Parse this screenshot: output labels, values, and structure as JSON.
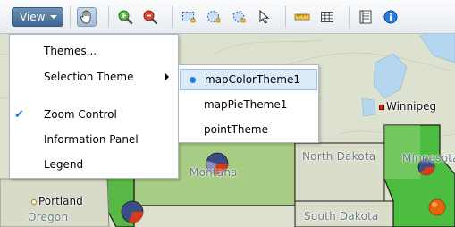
{
  "toolbar": {
    "view_label": "View",
    "tools": [
      {
        "name": "pan-hand-icon"
      },
      {
        "name": "zoom-in-icon"
      },
      {
        "name": "zoom-out-icon"
      },
      {
        "name": "rect-select-icon"
      },
      {
        "name": "circle-select-icon"
      },
      {
        "name": "polygon-select-icon"
      },
      {
        "name": "pointer-icon"
      },
      {
        "name": "distance-ruler-icon"
      },
      {
        "name": "grid-icon"
      },
      {
        "name": "information-panel-icon"
      },
      {
        "name": "legend-info-icon"
      }
    ]
  },
  "view_menu": {
    "items": [
      {
        "label": "Themes...",
        "checked": false,
        "submenu": false
      },
      {
        "label": "Selection Theme",
        "checked": false,
        "submenu": true
      },
      {
        "label": "Zoom Control",
        "checked": true,
        "submenu": false
      },
      {
        "label": "Information Panel",
        "checked": false,
        "submenu": false
      },
      {
        "label": "Legend",
        "checked": false,
        "submenu": false
      }
    ]
  },
  "selection_theme_menu": {
    "items": [
      {
        "label": "mapColorTheme1",
        "selected": true
      },
      {
        "label": "mapPieTheme1",
        "selected": false
      },
      {
        "label": "pointTheme",
        "selected": false
      }
    ]
  },
  "map": {
    "regions": [
      "Montana",
      "North Dakota",
      "South Dakota",
      "Oregon",
      "Minnesota"
    ],
    "cities": [
      "Winnipeg",
      "Portland"
    ],
    "colors": {
      "land": "#dfe3d2",
      "highlight_green": "#9ccf7a",
      "bright_green": "#4dbd42",
      "water": "#b5d6ef",
      "border": "#1a1a1a",
      "city_marker": "#e8640c",
      "pie_blue": "#3a4d86",
      "pie_red": "#d63b1d",
      "toolbar_accent": "#4a7099"
    }
  }
}
